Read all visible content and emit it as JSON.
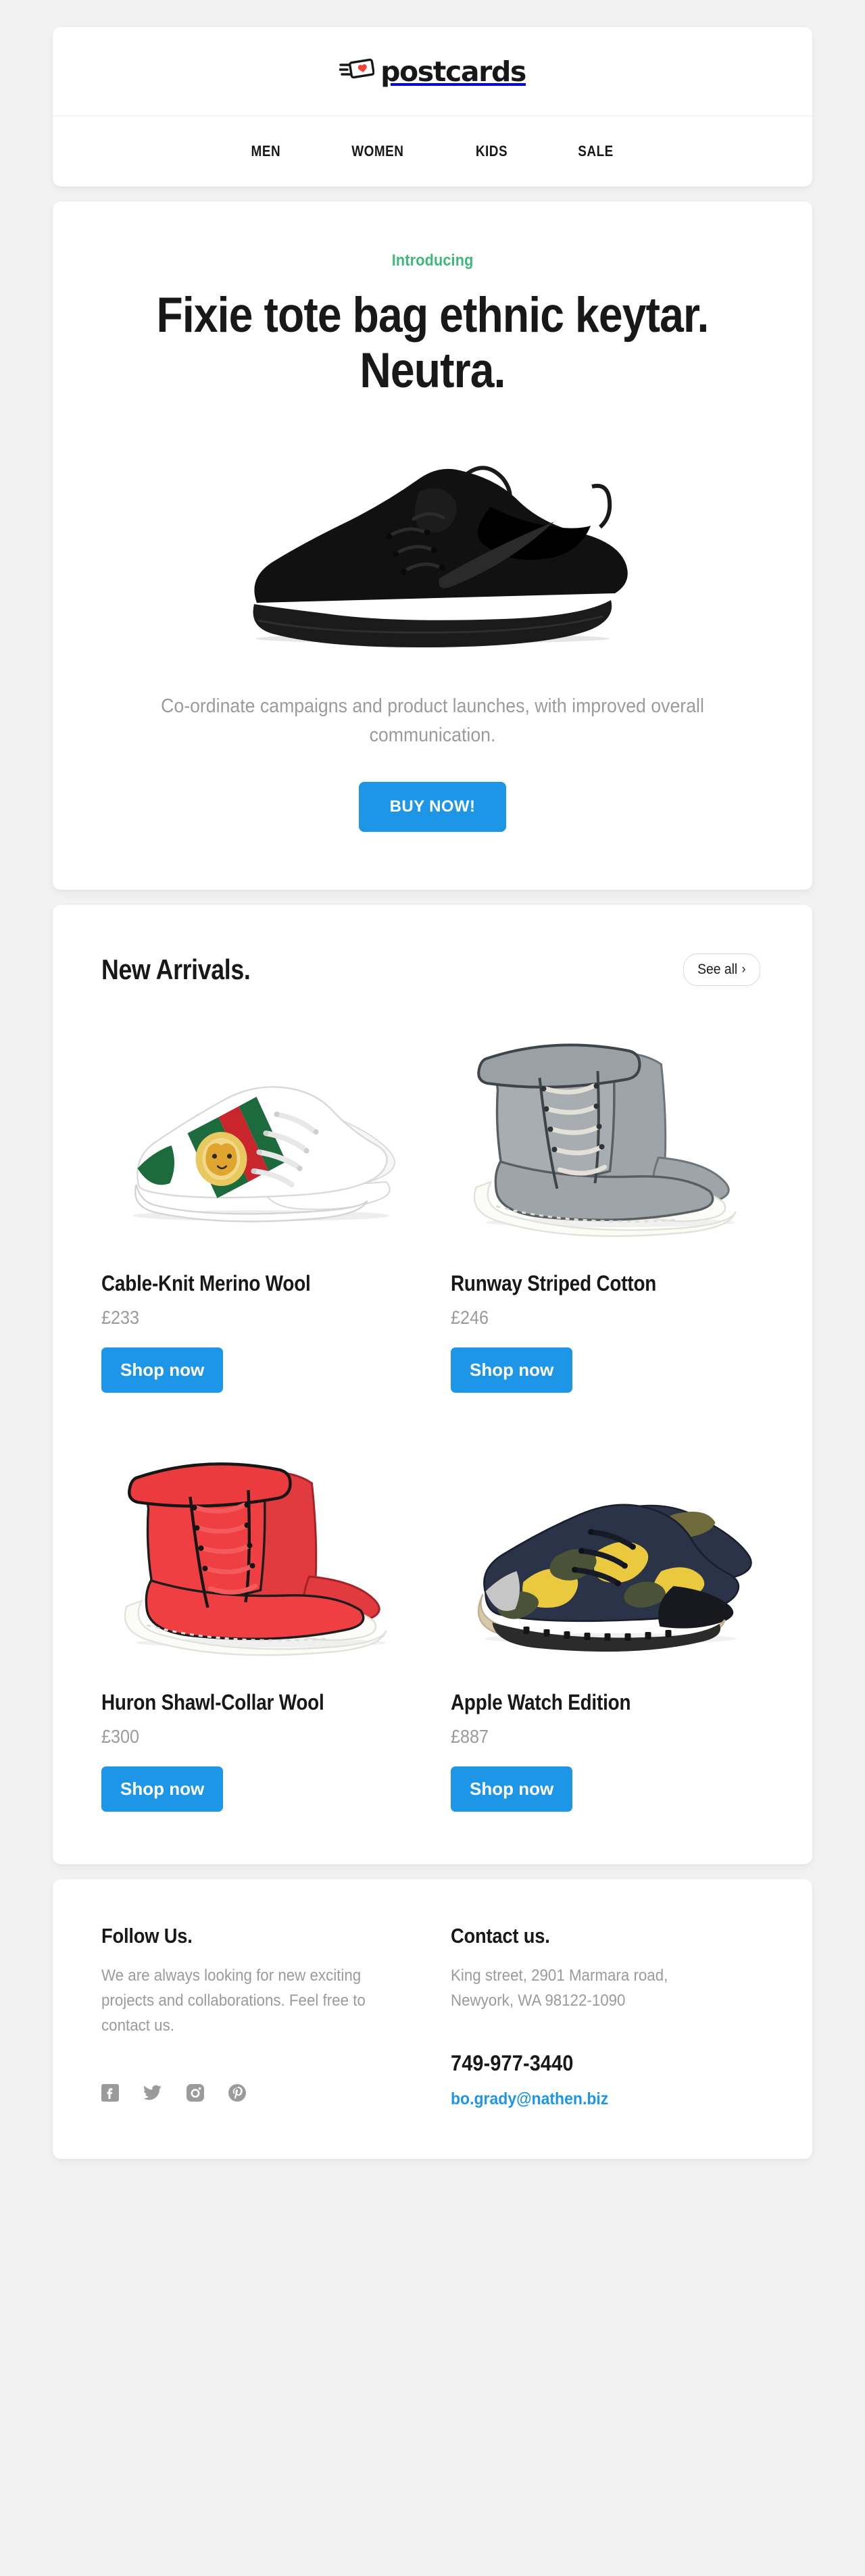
{
  "brand": {
    "name": "postcards",
    "logo_icon": "postcard-heart-icon",
    "accent_blue": "#1E96E8",
    "accent_green": "#3CB878",
    "heart_red": "#F44336"
  },
  "nav": {
    "items": [
      {
        "label": "MEN"
      },
      {
        "label": "WOMEN"
      },
      {
        "label": "KIDS"
      },
      {
        "label": "SALE"
      }
    ]
  },
  "hero": {
    "eyebrow": "Introducing",
    "title": "Fixie tote bag ethnic keytar. Neutra.",
    "image_alt": "black-nike-sneaker",
    "body": "Co-ordinate campaigns and product launches, with improved overall communication.",
    "cta_label": "BUY NOW!"
  },
  "arrivals": {
    "title": "New Arrivals.",
    "see_all_label": "See all",
    "see_all_chevron": "›",
    "products": [
      {
        "name": "Cable-Knit Merino Wool",
        "price": "£233",
        "cta_label": "Shop now",
        "image_alt": "white-tiger-patch-sneakers"
      },
      {
        "name": "Runway Striped Cotton",
        "price": "£246",
        "cta_label": "Shop now",
        "image_alt": "grey-military-high-top-sneakers"
      },
      {
        "name": "Huron Shawl-Collar Wool",
        "price": "£300",
        "cta_label": "Shop now",
        "image_alt": "red-military-high-top-sneakers"
      },
      {
        "name": "Apple Watch Edition",
        "price": "£887",
        "cta_label": "Shop now",
        "image_alt": "navy-yellow-camo-runner-sneakers"
      }
    ]
  },
  "footer": {
    "follow": {
      "title": "Follow Us.",
      "text": "We are always looking for new exciting projects and collaborations. Feel free to contact us.",
      "socials": [
        {
          "icon": "facebook-icon"
        },
        {
          "icon": "twitter-icon"
        },
        {
          "icon": "instagram-icon"
        },
        {
          "icon": "pinterest-icon"
        }
      ]
    },
    "contact": {
      "title": "Contact us.",
      "address": "King street, 2901 Marmara road, Newyork, WA 98122-1090",
      "phone": "749-977-3440",
      "email": "bo.grady@nathen.biz"
    }
  }
}
